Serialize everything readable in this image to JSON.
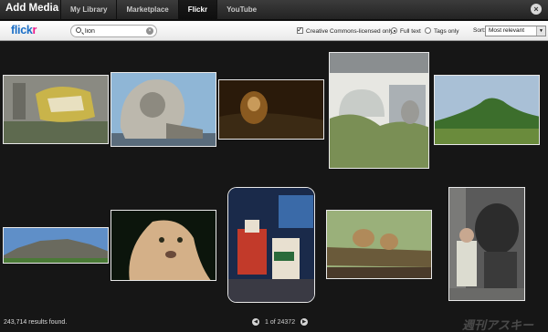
{
  "header": {
    "title": "Add Media",
    "tabs": [
      {
        "label": "My Library"
      },
      {
        "label": "Marketplace"
      },
      {
        "label": "Flickr",
        "active": true
      },
      {
        "label": "YouTube"
      }
    ],
    "close_icon": "close-x-icon"
  },
  "toolbar": {
    "logo_part1": "flick",
    "logo_part2": "r",
    "search_value": "lion",
    "creative_commons_label": "Creative Commons-licensed only",
    "creative_commons_checked": true,
    "fulltext_label": "Full text",
    "fulltext_selected": true,
    "tagsonly_label": "Tags only",
    "sort_label": "Sort:",
    "sort_value": "Most relevant"
  },
  "photos": [
    {
      "subject": "carousel lion statue",
      "colors": [
        "#8a8a82",
        "#c9b44a",
        "#5e6a4f"
      ]
    },
    {
      "subject": "stone lion sculpture",
      "colors": [
        "#8fb6d6",
        "#bcb8ad",
        "#7d7a70"
      ]
    },
    {
      "subject": "lion in grass at night",
      "colors": [
        "#2a1a0a",
        "#8a5a20",
        "#3b2a14"
      ]
    },
    {
      "subject": "lion statue in garden",
      "colors": [
        "#e7e7e2",
        "#7a8f55",
        "#9a9a96"
      ]
    },
    {
      "subject": "green hill landscape",
      "colors": [
        "#a9c0d6",
        "#3c6e2c",
        "#6a8b3c"
      ]
    },
    {
      "subject": "rock mountain landscape",
      "colors": [
        "#5f8fc8",
        "#6a6a5e",
        "#4a7a36"
      ]
    },
    {
      "subject": "lioness close-up",
      "colors": [
        "#0c150c",
        "#d4b088",
        "#2a3a1c"
      ]
    },
    {
      "subject": "robot figures",
      "colors": [
        "#1a2a4a",
        "#c23a2a",
        "#e8e0d0"
      ]
    },
    {
      "subject": "lion cubs on log",
      "colors": [
        "#9ab07a",
        "#b08a5a",
        "#6a5a3a"
      ]
    },
    {
      "subject": "person with lion statue",
      "colors": [
        "#5a5a5a",
        "#dcdcd0",
        "#2c2c2c"
      ]
    }
  ],
  "footer": {
    "results_count": "243,714 results found.",
    "page_info": "1 of 24372",
    "prev_icon": "arrow-left-icon",
    "next_icon": "arrow-right-icon",
    "watermark": "週刊アスキー"
  }
}
